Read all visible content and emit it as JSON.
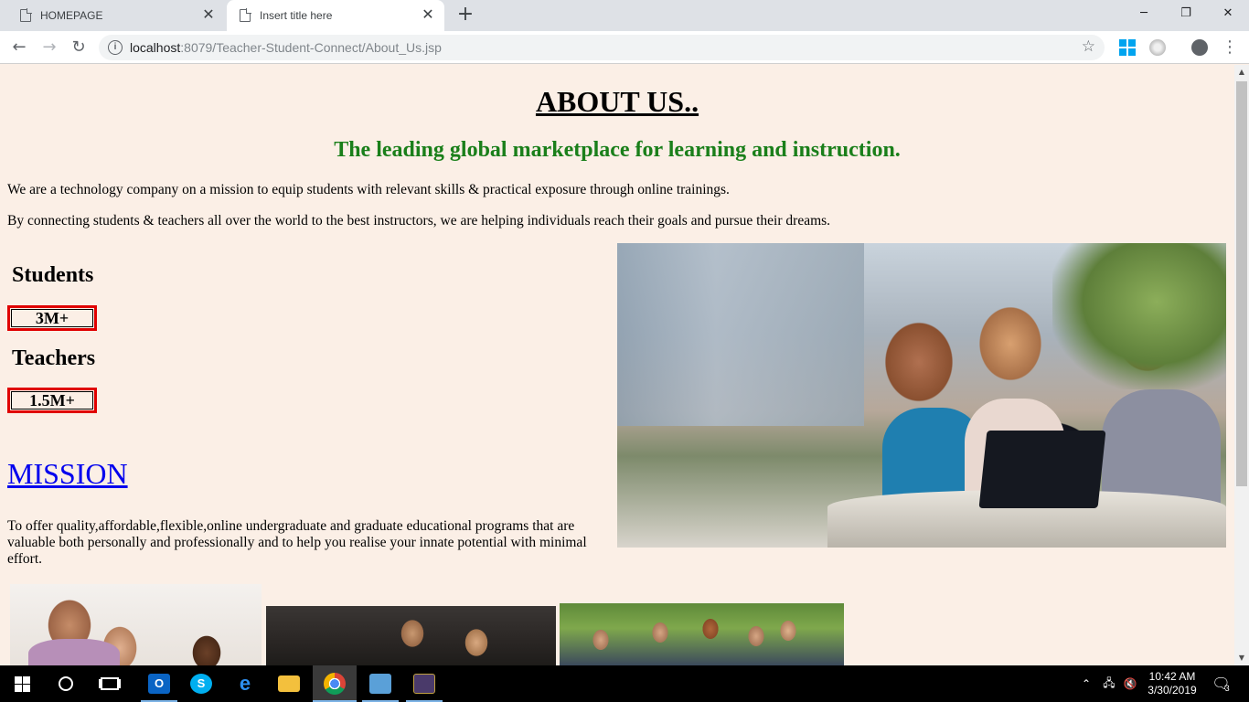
{
  "browser": {
    "tabs": [
      {
        "label": "HOMEPAGE",
        "active": false
      },
      {
        "label": "Insert title here",
        "active": true
      }
    ],
    "url_host": "localhost",
    "url_rest": ":8079/Teacher-Student-Connect/About_Us.jsp",
    "icons": {
      "back": "arrow-left-icon",
      "forward": "arrow-right-icon",
      "reload": "reload-icon",
      "info": "info-icon",
      "bookmark": "star-icon",
      "menu": "three-dots-icon"
    }
  },
  "page": {
    "heading": "ABOUT US..",
    "tagline": "The leading global marketplace for learning and instruction.",
    "intro1": "We are a technology company on a mission to equip students with relevant skills & practical exposure through online trainings.",
    "intro2": "By connecting students & teachers all over the world to the best instructors, we are helping individuals reach their goals and pursue their dreams.",
    "stats": [
      {
        "title": "Students",
        "value": "3M+"
      },
      {
        "title": "Teachers",
        "value": "1.5M+"
      }
    ],
    "mission_link": "MISSION",
    "mission_text": "To offer quality,affordable,flexible,online undergraduate and graduate educational programs that are valuable both personally and professionally and to help you realise your innate potential with minimal effort.",
    "colors": {
      "background": "#fbefe6",
      "tagline": "#1a7f1a",
      "stat_border": "#e00000",
      "link": "#0000ee"
    }
  },
  "taskbar": {
    "time": "10:42 AM",
    "date": "3/30/2019",
    "notification_count": "3",
    "apps": [
      "outlook-icon",
      "skype-icon",
      "edge-icon",
      "file-explorer-icon",
      "chrome-icon",
      "remote-desktop-icon",
      "app-icon"
    ]
  }
}
